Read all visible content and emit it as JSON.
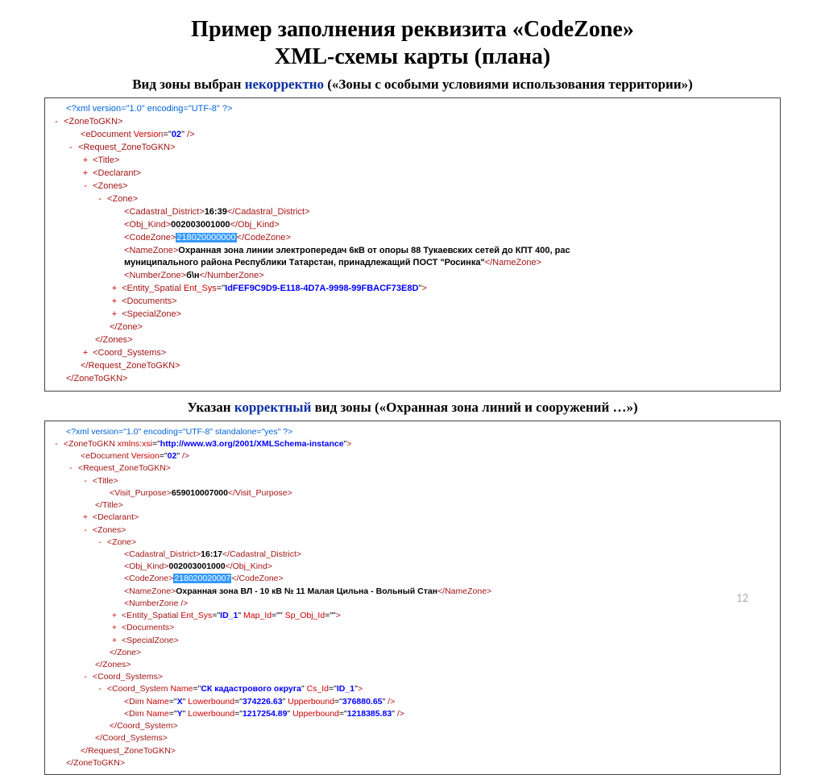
{
  "title_line1": "Пример заполнения реквизита «CodeZone»",
  "title_line2": "XML-схемы карты (плана)",
  "sub1_prefix": "Вид зоны выбран ",
  "sub1_hl": "некорректно",
  "sub1_suffix": " («Зоны с особыми условиями использования территории»)",
  "sub2_prefix": "Указан ",
  "sub2_hl": "корректный",
  "sub2_suffix": " вид зоны («Охранная зона линий и сооружений …»)",
  "pagenum": "12",
  "box1": {
    "xmldecl": "<?xml version=\"1.0\" encoding=\"UTF-8\" ?>",
    "root_open": "ZoneToGKN",
    "edoc_tag": "eDocument",
    "edoc_attr": "Version",
    "edoc_val": "02",
    "req_open": "Request_ZoneToGKN",
    "title_tag": "Title",
    "declarant_tag": "Declarant",
    "zones_tag": "Zones",
    "zone_tag": "Zone",
    "cad_tag": "Cadastral_District",
    "cad_val": "16:39",
    "obj_tag": "Obj_Kind",
    "obj_val": "002003001000",
    "code_tag": "CodeZone",
    "code_val": "218020000000",
    "name_tag": "NameZone",
    "name_txt1": "Охранная зона линии электропередач 6кВ от опоры 88 Тукаевских сетей до КПТ 400, рас",
    "name_txt2": "муниципального района Республики Татарстан, принадлежащий ПОСТ \"Росинка\"",
    "num_tag": "NumberZone",
    "num_val": "б\\н",
    "ent_tag": "Entity_Spatial",
    "ent_attr": "Ent_Sys",
    "ent_val": "IdFEF9C9D9-E118-4D7A-9998-99FBACF73E8D",
    "docs_tag": "Documents",
    "spec_tag": "SpecialZone",
    "coord_tag": "Coord_Systems",
    "req_close": "Request_ZoneToGKN",
    "root_close": "ZoneToGKN"
  },
  "box2": {
    "xmldecl": "<?xml version=\"1.0\" encoding=\"UTF-8\" standalone=\"yes\" ?>",
    "root_open_tag": "ZoneToGKN",
    "root_open_attr": "xmlns:xsi",
    "root_open_val": "http://www.w3.org/2001/XMLSchema-instance",
    "edoc_tag": "eDocument",
    "edoc_attr": "Version",
    "edoc_val": "02",
    "req_open": "Request_ZoneToGKN",
    "title_tag": "Title",
    "visit_tag": "Visit_Purpose",
    "visit_val": "659010007000",
    "declarant_tag": "Declarant",
    "zones_tag": "Zones",
    "zone_tag": "Zone",
    "cad_tag": "Cadastral_District",
    "cad_val": "16:17",
    "obj_tag": "Obj_Kind",
    "obj_val": "002003001000",
    "code_tag": "CodeZone",
    "code_val": "218020020007",
    "name_tag": "NameZone",
    "name_val": "Охранная зона ВЛ - 10 кВ № 11 Малая Цильна - Вольный Стан",
    "numzone": "NumberZone",
    "ent_tag": "Entity_Spatial",
    "ent_attr1": "Ent_Sys",
    "ent_val1": "ID_1",
    "ent_attr2": "Map_Id",
    "ent_attr3": "Sp_Obj_Id",
    "docs_tag": "Documents",
    "spec_tag": "SpecialZone",
    "coord_tag": "Coord_Systems",
    "coordsys_tag": "Coord_System",
    "coordsys_name_attr": "Name",
    "coordsys_name_val": "СК кадастрового округа",
    "coordsys_id_attr": "Cs_Id",
    "coordsys_id_val": "ID_1",
    "dim_tag": "Dim",
    "dim1_name": "X",
    "dim2_name": "Y",
    "lb_attr": "Lowerbound",
    "ub_attr": "Upperbound",
    "dim1_lb": "374226.63",
    "dim1_ub": "376880.65",
    "dim2_lb": "1217254.89",
    "dim2_ub": "1218385.83"
  }
}
